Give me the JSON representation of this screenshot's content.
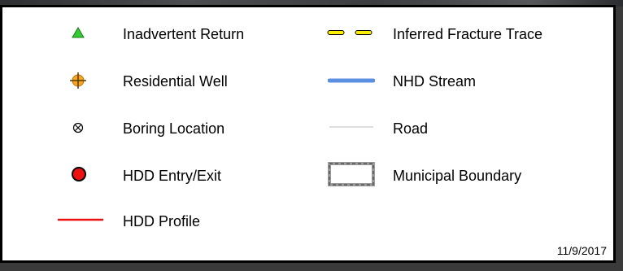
{
  "legend": {
    "items": [
      {
        "key": "inadvertent_return",
        "label": "Inadvertent Return",
        "icon": "green-triangle-icon",
        "color": "#33cc33"
      },
      {
        "key": "residential_well",
        "label": "Residential Well",
        "icon": "orange-crosshair-circle-icon",
        "color": "#f5a623"
      },
      {
        "key": "boring_location",
        "label": "Boring Location",
        "icon": "circle-x-icon",
        "color": "#000000"
      },
      {
        "key": "hdd_entry_exit",
        "label": "HDD Entry/Exit",
        "icon": "red-dot-icon",
        "color": "#ee1111"
      },
      {
        "key": "hdd_profile",
        "label": "HDD Profile",
        "icon": "red-line-icon",
        "color": "#ee1111"
      },
      {
        "key": "inferred_fracture_trace",
        "label": "Inferred Fracture Trace",
        "icon": "yellow-dashed-line-icon",
        "color": "#ffee00"
      },
      {
        "key": "nhd_stream",
        "label": "NHD Stream",
        "icon": "blue-line-icon",
        "color": "#5b8fe0"
      },
      {
        "key": "road",
        "label": "Road",
        "icon": "gray-line-icon",
        "color": "#d4d4d4"
      },
      {
        "key": "municipal_boundary",
        "label": "Municipal Boundary",
        "icon": "dashed-box-icon",
        "color": "#8a8a8a"
      }
    ],
    "date": "11/9/2017"
  }
}
